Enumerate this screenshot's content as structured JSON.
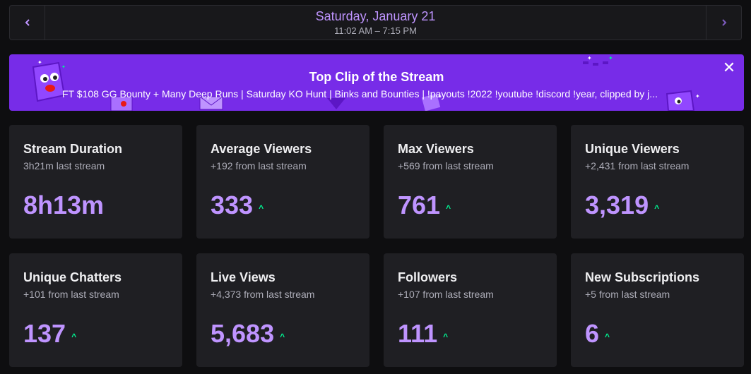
{
  "date_nav": {
    "prev_icon": "chevron-left",
    "next_icon": "chevron-right",
    "title": "Saturday, January 21",
    "time_range": "11:02 AM – 7:15 PM"
  },
  "banner": {
    "title": "Top Clip of the Stream",
    "description": "FT $108 GG Bounty + Many Deep Runs | Saturday KO Hunt | Binks and Bounties | !payouts !2022 !youtube !discord !year, clipped by j...",
    "close_icon": "close",
    "bg_color": "#772ce8"
  },
  "stats": [
    {
      "title": "Stream Duration",
      "sub": "3h21m last stream",
      "value": "8h13m",
      "trend": ""
    },
    {
      "title": "Average Viewers",
      "sub": "+192 from last stream",
      "value": "333",
      "trend": "up"
    },
    {
      "title": "Max Viewers",
      "sub": "+569 from last stream",
      "value": "761",
      "trend": "up"
    },
    {
      "title": "Unique Viewers",
      "sub": "+2,431 from last stream",
      "value": "3,319",
      "trend": "up"
    },
    {
      "title": "Unique Chatters",
      "sub": "+101 from last stream",
      "value": "137",
      "trend": "up"
    },
    {
      "title": "Live Views",
      "sub": "+4,373 from last stream",
      "value": "5,683",
      "trend": "up"
    },
    {
      "title": "Followers",
      "sub": "+107 from last stream",
      "value": "111",
      "trend": "up"
    },
    {
      "title": "New Subscriptions",
      "sub": "+5 from last stream",
      "value": "6",
      "trend": "up"
    }
  ],
  "colors": {
    "accent": "#bf94ff",
    "trend_up": "#00f593",
    "card_bg": "#1f1f23",
    "page_bg": "#0e0e10"
  }
}
